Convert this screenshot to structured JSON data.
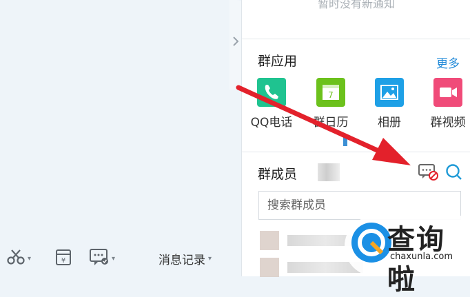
{
  "chat": {
    "toolbar": {
      "history_label": "消息记录",
      "caret": "▾"
    }
  },
  "panel": {
    "notice": "暂时没有新通知",
    "apps": {
      "title": "群应用",
      "more": "更多",
      "items": [
        {
          "label": "QQ电话",
          "icon": "phone-icon",
          "color": "#1fc390"
        },
        {
          "label": "群日历",
          "icon": "calendar-icon",
          "color": "#6cc11c"
        },
        {
          "label": "相册",
          "icon": "photo-album-icon",
          "color": "#1ea0e6"
        },
        {
          "label": "群视频",
          "icon": "video-icon",
          "color": "#f04b79"
        }
      ]
    },
    "members": {
      "title": "群成员",
      "search_placeholder": "搜索群成员"
    }
  },
  "watermark": {
    "brand_cn": "查询啦",
    "brand_en": "chaxunla.com"
  },
  "colors": {
    "accent_blue": "#1e88d8",
    "arrow_red": "#e3212b",
    "panel_bg": "#ffffff",
    "chat_bg": "#eef4f9"
  }
}
